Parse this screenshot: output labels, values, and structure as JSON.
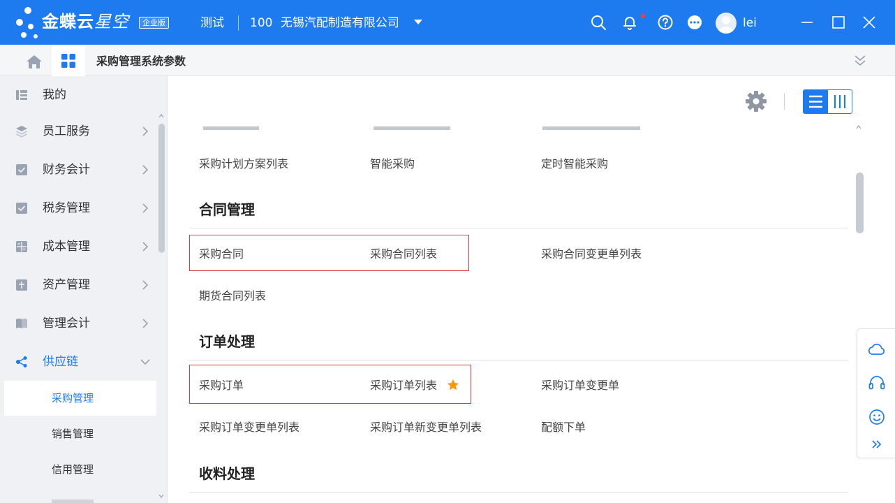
{
  "colors": {
    "primary": "#1e7bef",
    "highlight": "#e1393e",
    "star": "#ff9800",
    "sidebar_bg": "#eff1f5"
  },
  "titlebar": {
    "brand_main": "金蝶云",
    "brand_sub": "星空",
    "edition": "企业版",
    "env": "测试",
    "org_code": "100",
    "org_name": "无锡汽配制造有限公司",
    "user_name": "lei",
    "icons": [
      "search-icon",
      "bell-icon",
      "help-icon",
      "more-icon",
      "avatar",
      "minimize-icon",
      "maximize-icon",
      "close-icon"
    ]
  },
  "tabbar": {
    "page_tab": "采购管理系统参数"
  },
  "sidebar": {
    "items": [
      {
        "label": "我的",
        "icon": "my-icon"
      },
      {
        "label": "员工服务",
        "icon": "layers-icon"
      },
      {
        "label": "财务会计",
        "icon": "finance-icon"
      },
      {
        "label": "税务管理",
        "icon": "tax-icon"
      },
      {
        "label": "成本管理",
        "icon": "cost-icon"
      },
      {
        "label": "资产管理",
        "icon": "asset-icon"
      },
      {
        "label": "管理会计",
        "icon": "book-icon"
      },
      {
        "label": "供应链",
        "icon": "share-icon"
      }
    ],
    "sub_items": [
      {
        "label": "采购管理"
      },
      {
        "label": "销售管理"
      },
      {
        "label": "信用管理"
      }
    ]
  },
  "main": {
    "rows_top": [
      {
        "label": "采购计划方案列表"
      },
      {
        "label": "智能采购"
      },
      {
        "label": "定时智能采购"
      }
    ],
    "sections": [
      {
        "title": "合同管理",
        "links": [
          "采购合同",
          "采购合同列表",
          "采购合同变更单列表",
          "期货合同列表"
        ]
      },
      {
        "title": "订单处理",
        "links": [
          "采购订单",
          "采购订单列表",
          "采购订单变更单",
          "采购订单变更单列表",
          "采购订单新变更单列表",
          "配额下单"
        ]
      },
      {
        "title": "收料处理",
        "links": []
      }
    ]
  }
}
